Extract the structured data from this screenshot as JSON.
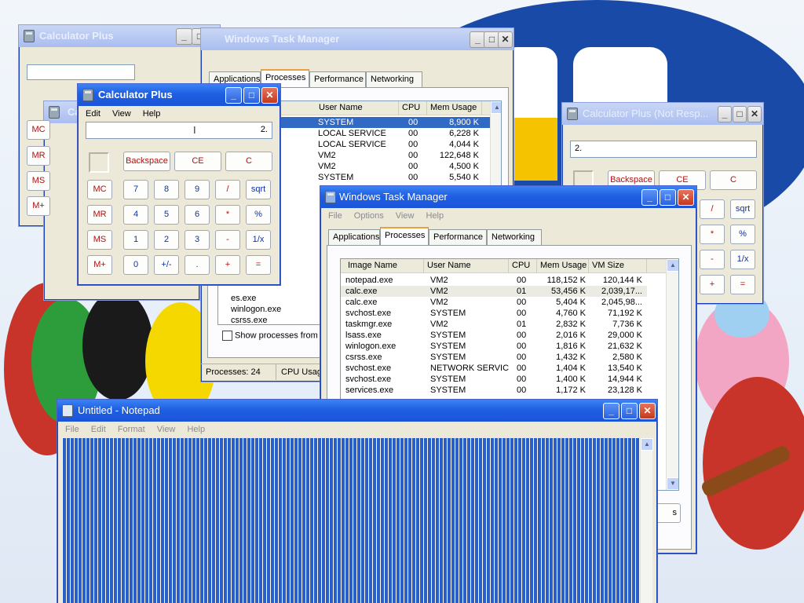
{
  "desktop": {
    "background_colors": {
      "sky": "#eef3fa",
      "logo_blue": "#1a4aa8",
      "logo_yellow": "#f6c300"
    }
  },
  "windows": {
    "calc_back": {
      "title": "Calculator Plus",
      "display_value": "",
      "buttons": [
        "MC",
        "MR",
        "MS",
        "M+"
      ]
    },
    "calc_back2": {
      "title_partial": "Ca"
    },
    "calc_front": {
      "title": "Calculator Plus",
      "menu": [
        "Edit",
        "View",
        "Help"
      ],
      "display_value": "2.",
      "memory_indicator": "",
      "top_buttons": [
        "Backspace",
        "CE",
        "C"
      ],
      "memory_buttons": [
        "MC",
        "MR",
        "MS",
        "M+"
      ],
      "rows": [
        [
          "7",
          "8",
          "9",
          "/",
          "sqrt"
        ],
        [
          "4",
          "5",
          "6",
          "*",
          "%"
        ],
        [
          "1",
          "2",
          "3",
          "-",
          "1/x"
        ],
        [
          "0",
          "+/-",
          ".",
          "+",
          "="
        ]
      ]
    },
    "calc_right": {
      "title": "Calculator Plus (Not Resp...",
      "display_value": "2.",
      "top_buttons": [
        "Backspace",
        "CE",
        "C"
      ],
      "rows": [
        [
          "/",
          "sqrt"
        ],
        [
          "*",
          "%"
        ],
        [
          "-",
          "1/x"
        ],
        [
          "+",
          "="
        ]
      ]
    },
    "tm_back": {
      "title": "Windows Task Manager",
      "tabs": [
        "Applications",
        "Processes",
        "Performance",
        "Networking"
      ],
      "columns": [
        "User Name",
        "CPU",
        "Mem Usage"
      ],
      "rows": [
        {
          "user": "SYSTEM",
          "cpu": "00",
          "mem": "8,900 K"
        },
        {
          "user": "LOCAL SERVICE",
          "cpu": "00",
          "mem": "6,228 K"
        },
        {
          "user": "LOCAL SERVICE",
          "cpu": "00",
          "mem": "4,044 K"
        },
        {
          "user": "VM2",
          "cpu": "00",
          "mem": "122,648 K"
        },
        {
          "user": "VM2",
          "cpu": "00",
          "mem": "4,500 K"
        },
        {
          "user": "SYSTEM",
          "cpu": "00",
          "mem": "5,540 K"
        }
      ],
      "partial_names": [
        "es.exe",
        "es.exe",
        "winlogon.exe",
        "csrss.exe"
      ],
      "show_all_label": "Show processes from a",
      "status_processes": "Processes: 24",
      "status_cpu": "CPU Usag"
    },
    "tm_front": {
      "title": "Windows Task Manager",
      "menu": [
        "File",
        "Options",
        "View",
        "Help"
      ],
      "tabs": [
        "Applications",
        "Processes",
        "Performance",
        "Networking"
      ],
      "columns": [
        "Image Name",
        "User Name",
        "CPU",
        "Mem Usage",
        "VM Size"
      ],
      "rows": [
        {
          "name": "notepad.exe",
          "user": "VM2",
          "cpu": "00",
          "mem": "118,152 K",
          "vm": "120,144 K"
        },
        {
          "name": "calc.exe",
          "user": "VM2",
          "cpu": "01",
          "mem": "53,456 K",
          "vm": "2,039,17..."
        },
        {
          "name": "calc.exe",
          "user": "VM2",
          "cpu": "00",
          "mem": "5,404 K",
          "vm": "2,045,98..."
        },
        {
          "name": "svchost.exe",
          "user": "SYSTEM",
          "cpu": "00",
          "mem": "4,760 K",
          "vm": "71,192 K"
        },
        {
          "name": "taskmgr.exe",
          "user": "VM2",
          "cpu": "01",
          "mem": "2,832 K",
          "vm": "7,736 K"
        },
        {
          "name": "lsass.exe",
          "user": "SYSTEM",
          "cpu": "00",
          "mem": "2,016 K",
          "vm": "29,000 K"
        },
        {
          "name": "winlogon.exe",
          "user": "SYSTEM",
          "cpu": "00",
          "mem": "1,816 K",
          "vm": "21,632 K"
        },
        {
          "name": "csrss.exe",
          "user": "SYSTEM",
          "cpu": "00",
          "mem": "1,432 K",
          "vm": "2,580 K"
        },
        {
          "name": "svchost.exe",
          "user": "NETWORK SERVICE",
          "cpu": "00",
          "mem": "1,404 K",
          "vm": "13,540 K"
        },
        {
          "name": "svchost.exe",
          "user": "SYSTEM",
          "cpu": "00",
          "mem": "1,400 K",
          "vm": "14,944 K"
        },
        {
          "name": "services.exe",
          "user": "SYSTEM",
          "cpu": "00",
          "mem": "1,172 K",
          "vm": "23,128 K"
        }
      ],
      "end_button_partial": "s"
    },
    "notepad": {
      "title": "Untitled - Notepad",
      "menu": [
        "File",
        "Edit",
        "Format",
        "View",
        "Help"
      ],
      "text_color": "#ffffff",
      "bg_color": "#2a5fc8"
    }
  }
}
